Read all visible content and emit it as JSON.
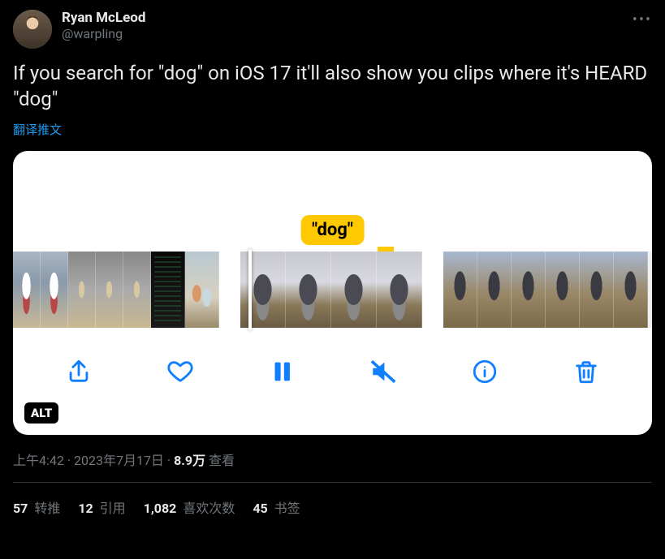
{
  "author": {
    "display_name": "Ryan McLeod",
    "handle": "@warpling"
  },
  "tweet_text": "If you search for \"dog\" on iOS 17 it'll also show you clips where it's HEARD \"dog\"",
  "translate_label": "翻译推文",
  "media": {
    "caption_bubble": "\"dog\"",
    "alt_badge": "ALT",
    "toolbar": {
      "share": "share",
      "like": "like",
      "pause": "pause",
      "mute": "mute",
      "info": "info",
      "delete": "delete"
    }
  },
  "meta": {
    "time": "上午4:42",
    "dot": " · ",
    "date": "2023年7月17日",
    "views_number": "8.9万",
    "views_label": " 查看"
  },
  "stats": {
    "retweets": {
      "count": "57",
      "label": " 转推"
    },
    "quotes": {
      "count": "12",
      "label": " 引用"
    },
    "likes": {
      "count": "1,082",
      "label": " 喜欢次数"
    },
    "bookmarks": {
      "count": "45",
      "label": " 书签"
    }
  }
}
